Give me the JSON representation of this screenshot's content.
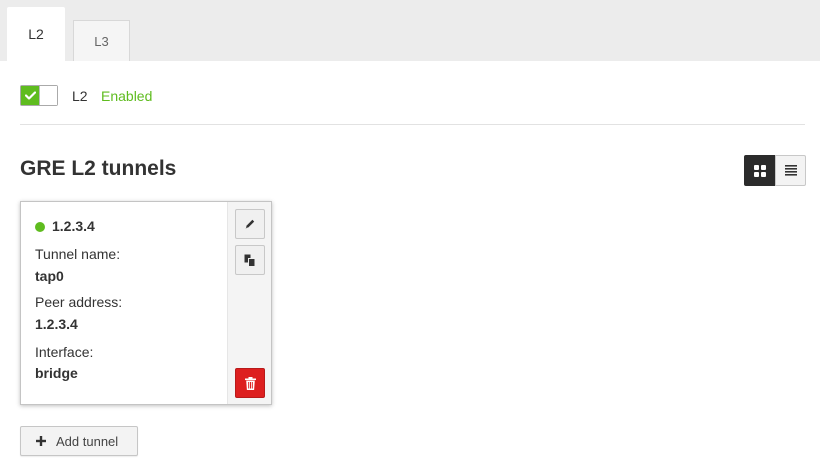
{
  "tabs": [
    {
      "label": "L2",
      "active": true
    },
    {
      "label": "L3",
      "active": false
    }
  ],
  "service": {
    "name": "L2",
    "status": "Enabled",
    "enabled": true
  },
  "section": {
    "title": "GRE L2 tunnels",
    "view_modes": [
      "grid-icon",
      "list-icon"
    ],
    "active_view": "grid"
  },
  "tunnels": [
    {
      "title": "1.2.3.4",
      "online": true,
      "fields": [
        {
          "label": "Tunnel name:",
          "value": "tap0"
        },
        {
          "label": "Peer address:",
          "value": "1.2.3.4"
        },
        {
          "label": "Interface:",
          "value": "bridge"
        }
      ],
      "actions": [
        "pencil-icon",
        "copy-icon",
        "trash-icon"
      ]
    }
  ],
  "add_button": {
    "label": "Add tunnel",
    "icon": "plus-icon"
  },
  "colors": {
    "accent_green": "#5fbc1f",
    "danger_red": "#dd1f1f",
    "dark": "#2b2b2b"
  }
}
